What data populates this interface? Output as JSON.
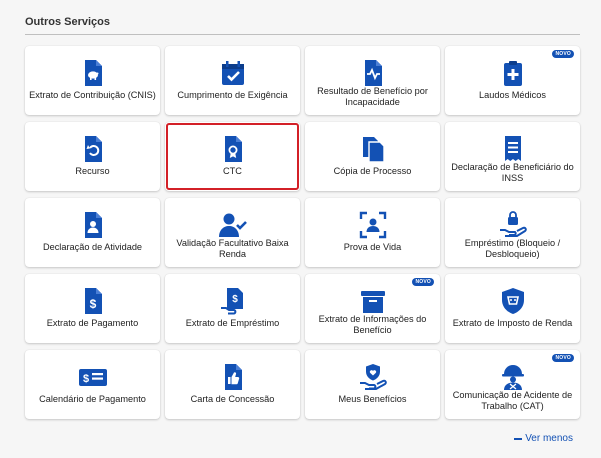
{
  "section": {
    "title": "Outros Serviços"
  },
  "accent_color": "#1351b4",
  "selection_color": "#d32027",
  "badge_label": "NOVO",
  "cards": [
    {
      "label": "Extrato de Contribuição (CNIS)",
      "icon": "piggy-bank-doc-icon"
    },
    {
      "label": "Cumprimento de Exigência",
      "icon": "calendar-check-icon"
    },
    {
      "label": "Resultado de Benefício por Incapacidade",
      "icon": "heartbeat-doc-icon"
    },
    {
      "label": "Laudos Médicos",
      "icon": "medical-clipboard-icon",
      "badge": "NOVO"
    },
    {
      "label": "Recurso",
      "icon": "undo-doc-icon"
    },
    {
      "label": "CTC",
      "icon": "certificate-doc-icon",
      "selected": true
    },
    {
      "label": "Cópia de Processo",
      "icon": "copy-icon"
    },
    {
      "label": "Declaração de Beneficiário do INSS",
      "icon": "receipt-icon"
    },
    {
      "label": "Declaração de Atividade",
      "icon": "person-doc-icon"
    },
    {
      "label": "Validação Facultativo Baixa Renda",
      "icon": "user-check-icon"
    },
    {
      "label": "Prova de Vida",
      "icon": "face-scan-icon"
    },
    {
      "label": "Empréstimo (Bloqueio / Desbloqueio)",
      "icon": "hand-lock-icon"
    },
    {
      "label": "Extrato de Pagamento",
      "icon": "dollar-doc-icon"
    },
    {
      "label": "Extrato de Empréstimo",
      "icon": "hand-dollar-doc-icon"
    },
    {
      "label": "Extrato de Informações do Benefício",
      "icon": "archive-box-icon",
      "badge": "NOVO"
    },
    {
      "label": "Extrato de Imposto de Renda",
      "icon": "lion-shield-icon"
    },
    {
      "label": "Calendário de Pagamento",
      "icon": "money-bill-icon"
    },
    {
      "label": "Carta de Concessão",
      "icon": "thumbs-up-doc-icon"
    },
    {
      "label": "Meus Benefícios",
      "icon": "hand-heart-shield-icon"
    },
    {
      "label": "Comunicação de Acidente de Trabalho (CAT)",
      "icon": "hard-hat-worker-icon",
      "badge": "NOVO"
    }
  ],
  "footer": {
    "toggle_label": "Ver menos"
  }
}
